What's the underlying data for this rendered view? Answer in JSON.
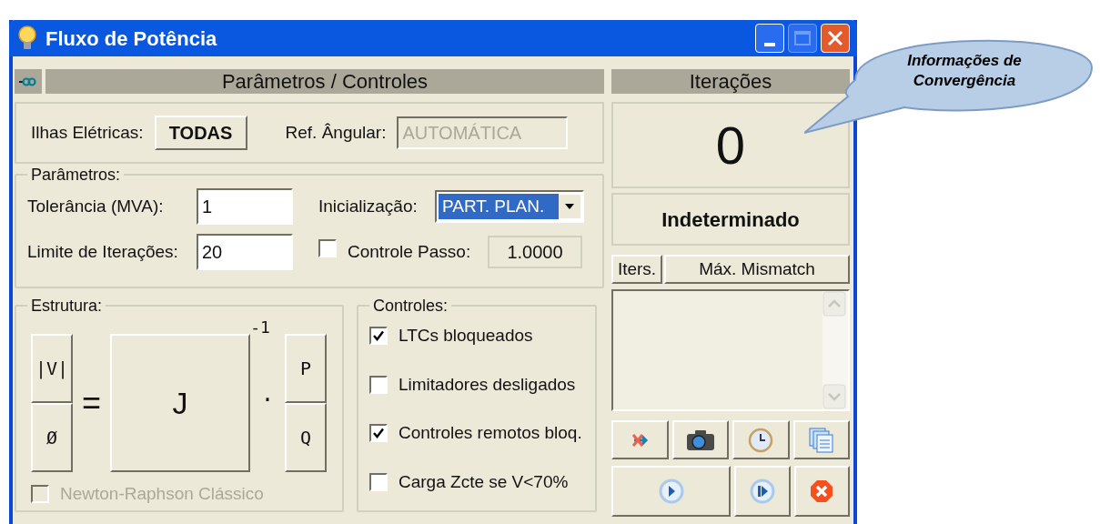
{
  "window": {
    "title": "Fluxo de Potência"
  },
  "params_panel": {
    "header": "Parâmetros / Controles",
    "islands_label": "Ilhas Elétricas:",
    "islands_button": "TODAS",
    "ref_label": "Ref. Ângular:",
    "ref_value": "AUTOMÁTICA",
    "ref_disabled": true
  },
  "parameters": {
    "legend": "Parâmetros:",
    "tolerance": {
      "label": "Tolerância (MVA):",
      "value": "1"
    },
    "iter_limit": {
      "label": "Limite de Iterações:",
      "value": "20"
    },
    "init": {
      "label": "Inicialização:",
      "value": "PART. PLAN."
    },
    "step_control": {
      "label": "Controle Passo:",
      "checked": false,
      "value": "1.0000"
    }
  },
  "structure": {
    "legend": "Estrutura:",
    "exponent": "-1",
    "left_vector": [
      "|V|",
      "Ø"
    ],
    "equals": "=",
    "matrix": "J",
    "dot": ".",
    "right_vector": [
      "P",
      "Q"
    ],
    "newton_raphson": {
      "label": "Newton-Raphson Clássico",
      "checked": false,
      "disabled": true
    }
  },
  "controls": {
    "legend": "Controles:",
    "items": [
      {
        "label": "LTCs bloqueados",
        "checked": true
      },
      {
        "label": "Limitadores desligados",
        "checked": false
      },
      {
        "label": "Controles remotos bloq.",
        "checked": true
      },
      {
        "label": "Carga Zcte se V<70%",
        "checked": false
      }
    ]
  },
  "iterations": {
    "header": "Iterações",
    "count": "0",
    "status": "Indeterminado",
    "columns": [
      "Iters.",
      "Máx. Mismatch"
    ]
  },
  "callout": {
    "text": "Informações de Convergência"
  }
}
